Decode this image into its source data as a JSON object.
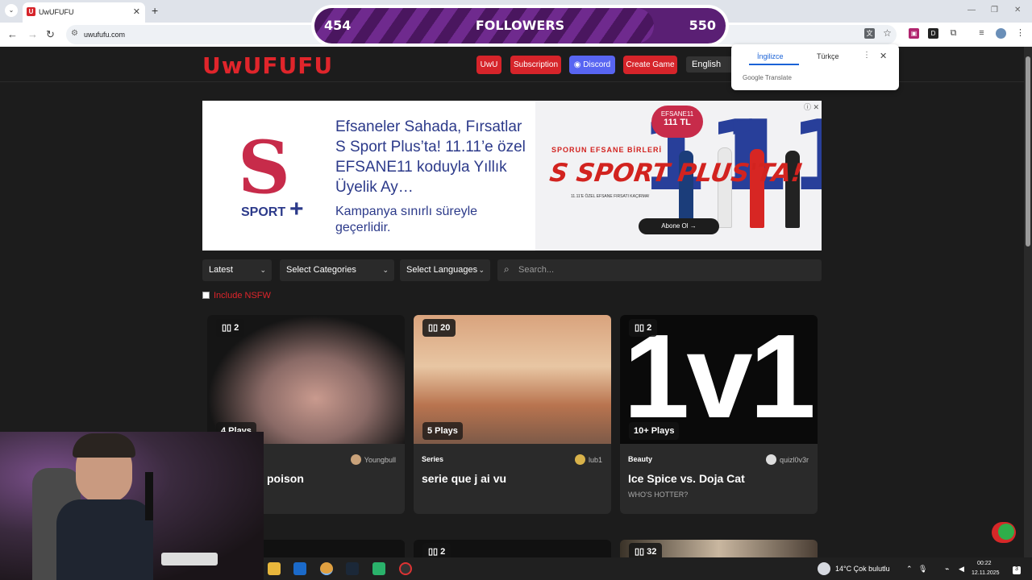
{
  "browser": {
    "tab_title": "UwUFUFU",
    "tab_favicon": "U",
    "url": "uwufufu.com"
  },
  "followers_widget": {
    "current": "454",
    "label": "FOLLOWERS",
    "goal": "550",
    "progress": 0.826
  },
  "site": {
    "logo": "UwUFUFU",
    "nav": {
      "uwu": "UwU",
      "subscription": "Subscription",
      "discord": "Discord",
      "create_game": "Create Game",
      "language": "English"
    }
  },
  "translate_popup": {
    "lang_active": "İngilizce",
    "lang_other": "Türkçe",
    "brand": "Google Translate"
  },
  "ad": {
    "headline": "Efsaneler Sahada, Fırsatlar S Sport Plus’ta! 11.11’e özel EFSANE11 koduyla Yıllık Üyelik Ay…",
    "sub": "Kampanya sınırlı süreyle geçerlidir.",
    "logo_text": "SPORT",
    "banner_slogan": "SPORUN EFSANE BİRLERİ",
    "banner_big": "S SPORT PLUS'TA!",
    "banner_small": "11.11'E ÖZEL EFSANE FIRSATI KAÇIRMA!",
    "badge_top": "EFSANE11",
    "badge_price": "111 TL",
    "cta": "Abone Ol →"
  },
  "filters": {
    "sort": "Latest",
    "categories": "Select Categories",
    "languages": "Select Languages",
    "search_placeholder": "Search...",
    "nsfw_label": "Include NSFW"
  },
  "cards": [
    {
      "count": "2",
      "plays": "4 Plays",
      "category": "",
      "author": "Youngbull",
      "title": "poison",
      "desc": ""
    },
    {
      "count": "20",
      "plays": "5 Plays",
      "category": "Series",
      "author": "lub1",
      "title": "serie que j ai vu",
      "desc": ""
    },
    {
      "count": "2",
      "plays": "10+ Plays",
      "category": "Beauty",
      "author": "quizl0v3r",
      "title": "Ice Spice vs. Doja Cat",
      "desc": "WHO'S HOTTER?",
      "image_text": "1v1"
    }
  ],
  "cards_row2": [
    {
      "count": ""
    },
    {
      "count": "2"
    },
    {
      "count": "32"
    }
  ],
  "taskbar": {
    "weather": "14°C  Çok bulutlu",
    "time": "00:22",
    "date": "12.11.2025"
  },
  "colors": {
    "brand_red": "#d6242a",
    "discord_blue": "#5865f2",
    "followers_purple": "#5a1f74"
  }
}
